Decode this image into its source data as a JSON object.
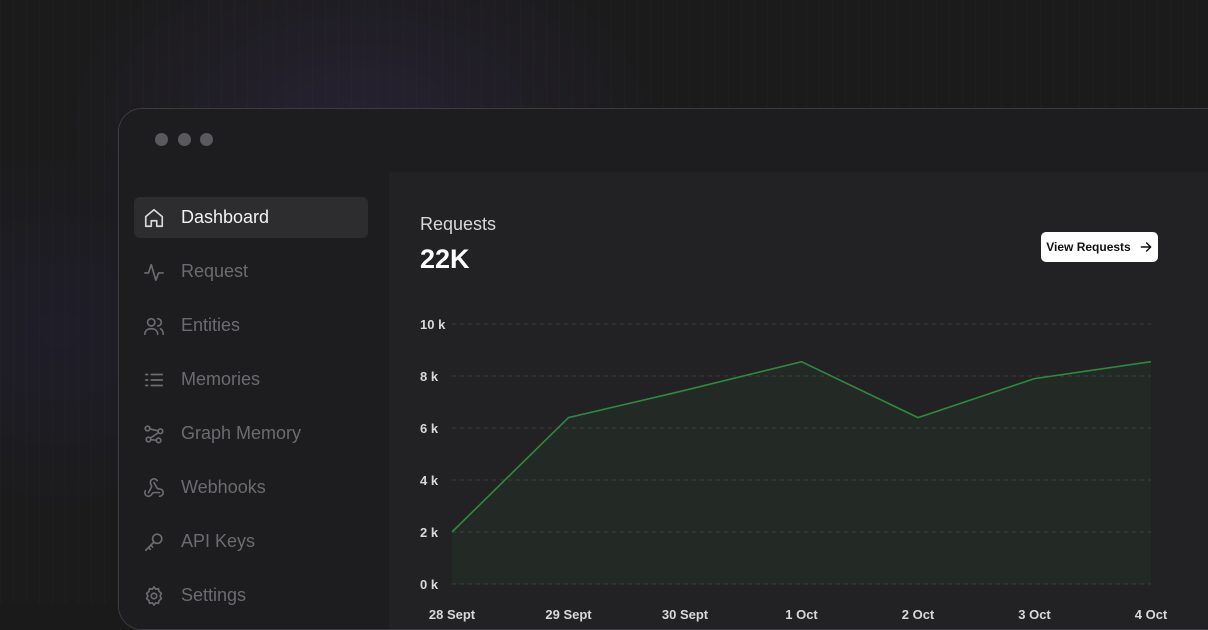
{
  "window": {
    "dots": [
      "close",
      "minimize",
      "maximize"
    ]
  },
  "sidebar": {
    "items": [
      {
        "label": "Dashboard",
        "icon": "home-icon",
        "active": true
      },
      {
        "label": "Request",
        "icon": "activity-icon",
        "active": false
      },
      {
        "label": "Entities",
        "icon": "users-icon",
        "active": false
      },
      {
        "label": "Memories",
        "icon": "list-icon",
        "active": false
      },
      {
        "label": "Graph Memory",
        "icon": "graph-icon",
        "active": false
      },
      {
        "label": "Webhooks",
        "icon": "webhook-icon",
        "active": false
      },
      {
        "label": "API Keys",
        "icon": "key-icon",
        "active": false
      },
      {
        "label": "Settings",
        "icon": "gear-icon",
        "active": false
      }
    ]
  },
  "main": {
    "title": "Requests",
    "value": "22K",
    "view_button": "View Requests"
  },
  "colors": {
    "accent_line": "#2f8a3e",
    "background": "#222224",
    "active_item": "#2d2d30"
  },
  "chart_data": {
    "type": "area",
    "x": [
      "28 Sept",
      "29 Sept",
      "30 Sept",
      "1 Oct",
      "2 Oct",
      "3 Oct",
      "4 Oct"
    ],
    "y_ticks": [
      "0 k",
      "2 k",
      "4 k",
      "6 k",
      "8 k",
      "10 k"
    ],
    "ylim": [
      0,
      10000
    ],
    "grid": true,
    "points": [
      {
        "x": "28 Sept",
        "y": 2000
      },
      {
        "x": "29 Sept",
        "y": 6400
      },
      {
        "x": "30 Sept",
        "y": 7450
      },
      {
        "x": "1 Oct",
        "y": 8550
      },
      {
        "x": "2 Oct",
        "y": 6400
      },
      {
        "x": "3 Oct",
        "y": 7900
      },
      {
        "x": "4 Oct",
        "y": 8550
      }
    ]
  }
}
